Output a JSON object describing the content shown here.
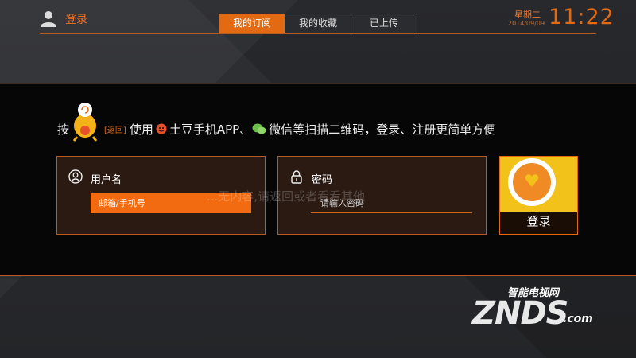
{
  "header": {
    "login_label": "登录",
    "tabs": [
      {
        "label": "我的订阅",
        "active": true
      },
      {
        "label": "我的收藏",
        "active": false
      },
      {
        "label": "已上传",
        "active": false
      }
    ],
    "weekday": "星期二",
    "date": "2014/09/09",
    "time": "11:22"
  },
  "login": {
    "instruction_prefix": "按",
    "back_label": "[返回]",
    "instruction_use": "使用",
    "instruction_app": "土豆手机APP、",
    "instruction_rest": "微信等扫描二维码，登录、注册更简单方便",
    "username_label": "用户名",
    "username_value": "邮箱/手机号",
    "password_label": "密码",
    "password_placeholder": "请输入密码",
    "empty_hint": "...无内容,请返回或者看看其他",
    "login_button": "登录"
  },
  "watermark": {
    "top": "智能电视网",
    "main": "ZNDS",
    "suffix": ".com"
  },
  "colors": {
    "accent": "#e26a13",
    "panel": "#060606",
    "field_bg": "#2a1a12"
  },
  "icons": [
    "user-icon",
    "mascot-icon",
    "tudou-icon",
    "wechat-icon",
    "lock-icon",
    "person-outline-icon"
  ]
}
